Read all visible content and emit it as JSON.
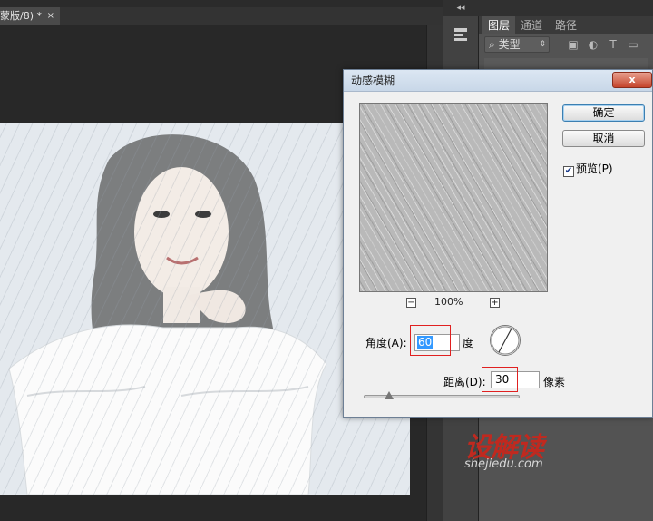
{
  "document": {
    "tab_label": "蒙版/8) *",
    "close_glyph": "×"
  },
  "dock": {
    "collapse_glyph": "◂◂"
  },
  "layers_panel": {
    "tabs": [
      "图层",
      "通道",
      "路径"
    ],
    "filter_kind_label": "类型",
    "filter_icons": [
      "image-filter-icon",
      "adjustment-filter-icon",
      "text-filter-icon",
      "shape-filter-icon"
    ]
  },
  "dialog": {
    "title": "动感模糊",
    "close_glyph": "x",
    "ok_label": "确定",
    "cancel_label": "取消",
    "preview_checkbox": {
      "label": "预览(P)",
      "checked": true
    },
    "zoom": {
      "level": "100%",
      "zoom_out": "−",
      "zoom_in": "+"
    },
    "angle": {
      "label": "角度(A):",
      "value": "60",
      "unit": "度"
    },
    "distance": {
      "label": "距离(D):",
      "value": "30",
      "unit": "像素"
    }
  },
  "watermark": {
    "title": "设解读",
    "url": "shejiedu.com"
  },
  "colors": {
    "close_red": "#c5442b",
    "highlight_red": "#e02020",
    "watermark_red": "#c0291f",
    "selection_blue": "#3399ff"
  }
}
